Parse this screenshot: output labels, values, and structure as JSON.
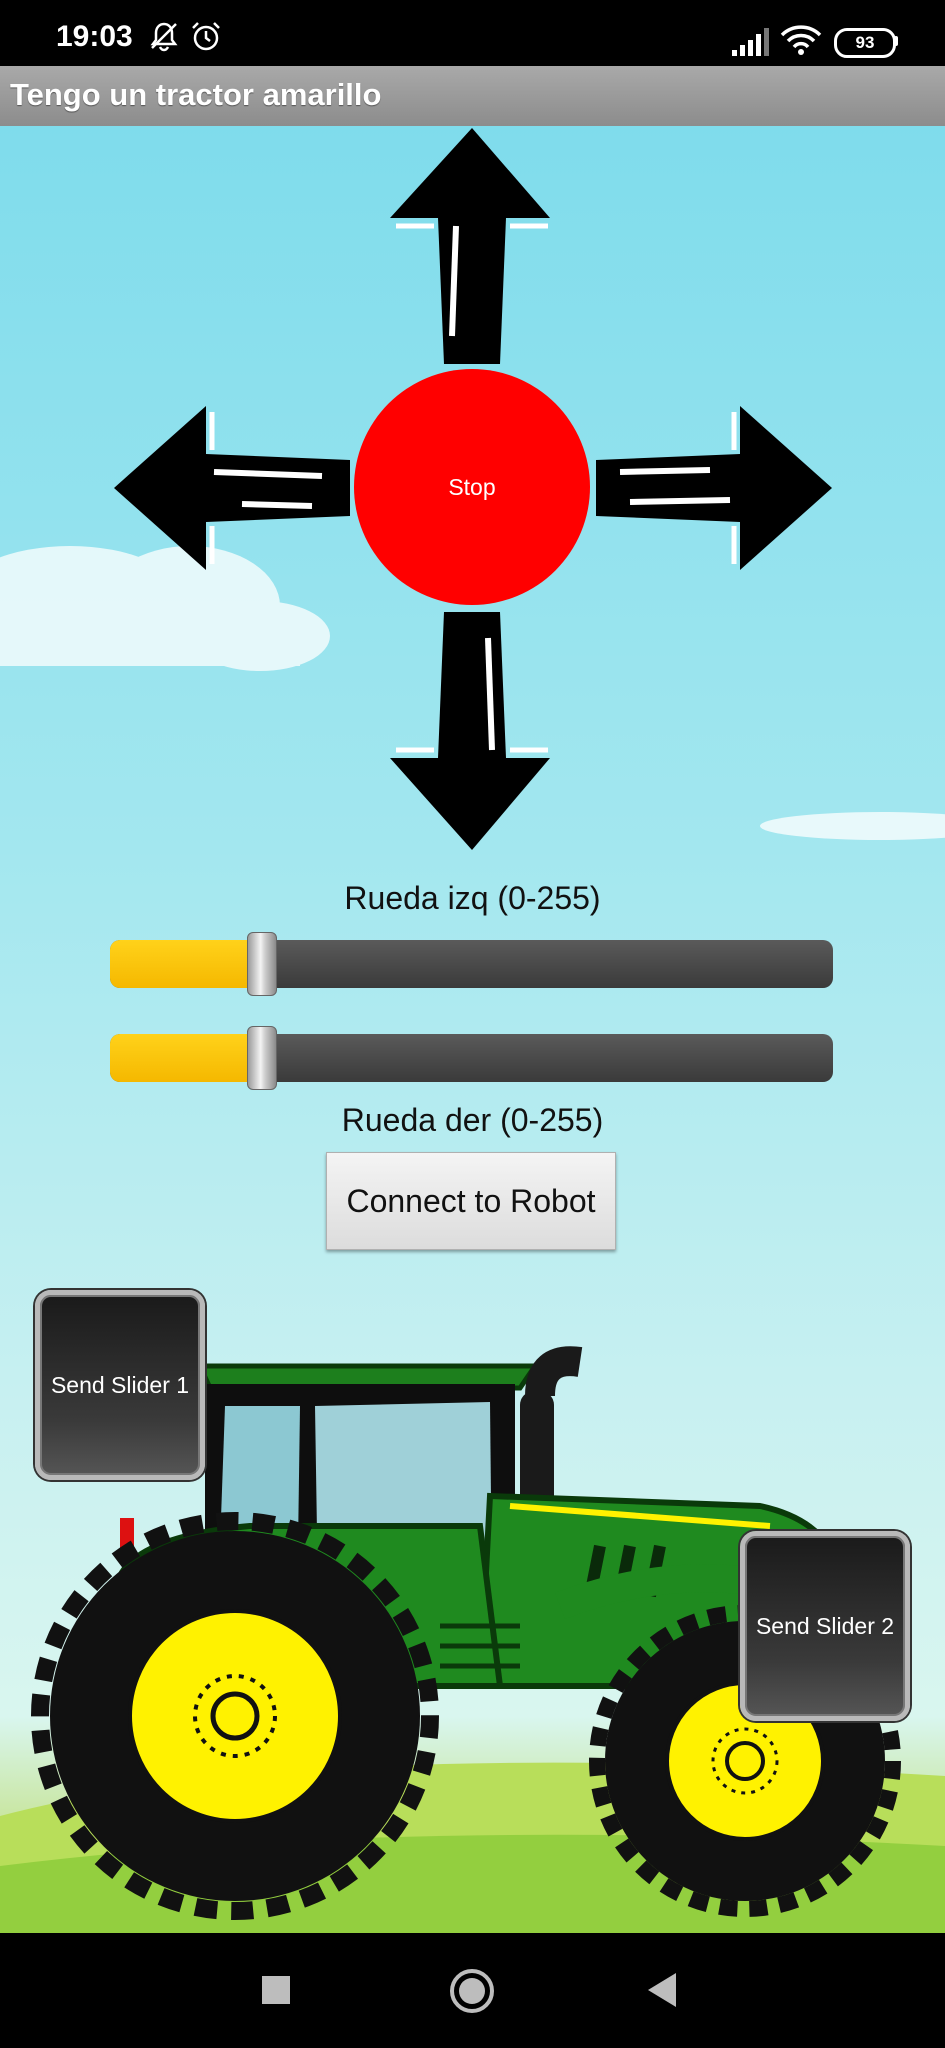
{
  "status": {
    "time": "19:03",
    "battery": "93"
  },
  "app": {
    "title": "Tengo un tractor amarillo"
  },
  "controls": {
    "stop_label": "Stop"
  },
  "sliders": [
    {
      "label": "Rueda izq (0-255)",
      "value": 0.21
    },
    {
      "label": "Rueda der (0-255)",
      "value": 0.21
    }
  ],
  "buttons": {
    "connect": "Connect to Robot",
    "send_slider_1": "Send Slider 1",
    "send_slider_2": "Send Slider 2"
  },
  "colors": {
    "stop": "#ff0000",
    "slider_fill": "#ffcc00",
    "tractor_body": "#1f8a1f",
    "wheel_hub": "#fff200"
  }
}
